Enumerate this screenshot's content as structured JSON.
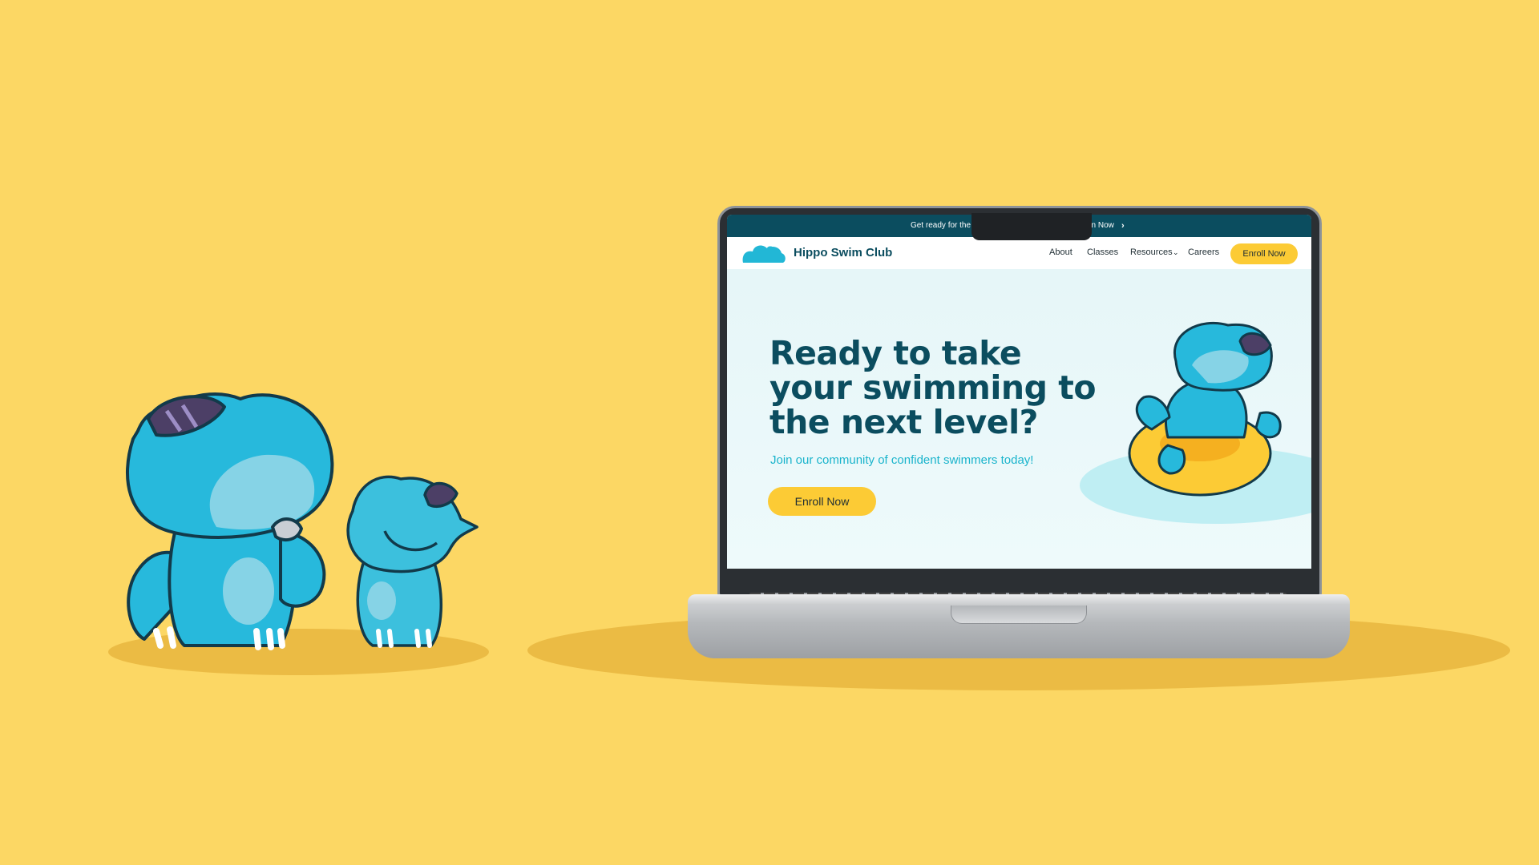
{
  "announcement": {
    "text_left": "Get ready for the",
    "text_right": "en Now",
    "chevron_icon": "chevron-right-icon"
  },
  "nav": {
    "brand": "Hippo Swim Club",
    "links": [
      "About",
      "Classes",
      "Resources",
      "Careers"
    ],
    "resources_chevron_icon": "chevron-down-icon",
    "cta": "Enroll Now"
  },
  "hero": {
    "title": "Ready to take your swimming to the next level?",
    "subtitle": "Join our community of confident swimmers today!",
    "cta": "Enroll Now"
  },
  "colors": {
    "background": "#FCD764",
    "brand_dark": "#0b4d5f",
    "accent_cyan": "#1ab4cc",
    "button_yellow": "#FCCB35"
  }
}
